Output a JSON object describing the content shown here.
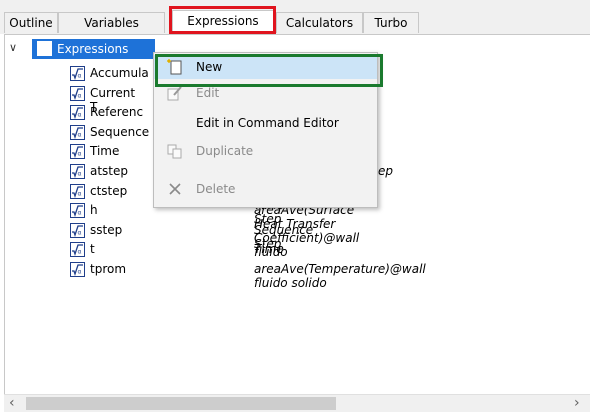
{
  "tabs": [
    {
      "label": "Outline"
    },
    {
      "label": "Variables"
    },
    {
      "label": "Expressions"
    },
    {
      "label": "Calculators"
    },
    {
      "label": "Turbo"
    }
  ],
  "tree": {
    "root_label": "Expressions",
    "items": [
      {
        "name": "Accumula",
        "value": ""
      },
      {
        "name": "Current T",
        "value": ""
      },
      {
        "name": "Referenc",
        "value": ""
      },
      {
        "name": "Sequence",
        "value": ""
      },
      {
        "name": "Time",
        "value": ""
      },
      {
        "name": "atstep",
        "value": "ep"
      },
      {
        "name": "ctstep",
        "value": "Current Time Step"
      },
      {
        "name": "h",
        "value": "areaAve(Surface Heat Transfer Coefficient)@wall fluido"
      },
      {
        "name": "sstep",
        "value": "Sequence Step"
      },
      {
        "name": "t",
        "value": "Time"
      },
      {
        "name": "tprom",
        "value": "areaAve(Temperature)@wall fluido solido"
      }
    ]
  },
  "context_menu": {
    "items": [
      {
        "label": "New",
        "icon": "new-icon",
        "enabled": true
      },
      {
        "label": "Edit",
        "icon": "edit-icon",
        "enabled": false
      },
      {
        "label": "Edit in Command Editor",
        "icon": "",
        "enabled": true
      },
      {
        "label": "Duplicate",
        "icon": "duplicate-icon",
        "enabled": false
      },
      {
        "label": "Delete",
        "icon": "delete-icon",
        "enabled": false
      }
    ]
  },
  "colors": {
    "selection": "#1e72d8",
    "highlight_tab": "#e0141e",
    "highlight_menu": "#1a7a2e"
  }
}
